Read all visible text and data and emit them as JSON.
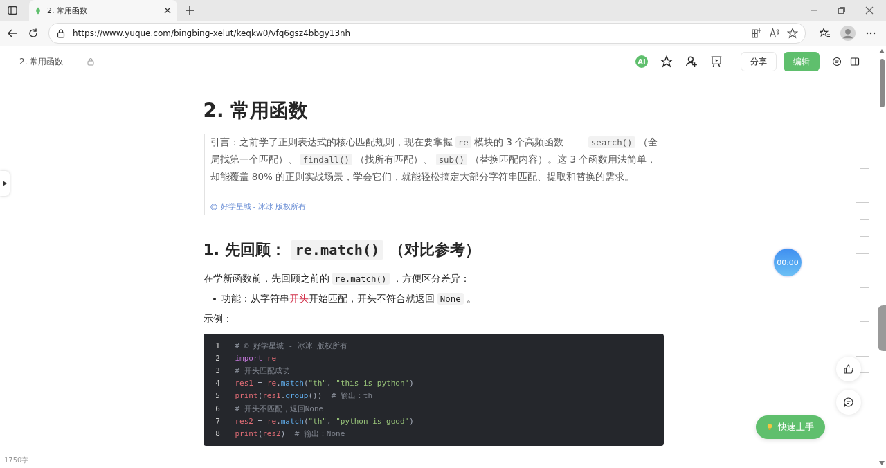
{
  "browser": {
    "tab_title": "2. 常用函数",
    "url": "https://www.yuque.com/bingbing-xelut/keqkw0/vfq6gsz4bbgy13nh"
  },
  "header": {
    "doc_title": "2. 常用函数",
    "ai_badge": "AI",
    "share": "分享",
    "edit": "编辑"
  },
  "doc": {
    "title": "2. 常用函数",
    "intro": [
      {
        "kind": "text",
        "text": "引言：之前学了正则表达式的核心匹配规则，现在要掌握 "
      },
      {
        "kind": "code",
        "text": "re"
      },
      {
        "kind": "text",
        "text": " 模块的 3 个高频函数 —— "
      },
      {
        "kind": "code",
        "text": "search()"
      },
      {
        "kind": "text",
        "text": " （全局找第一个匹配）、 "
      },
      {
        "kind": "code",
        "text": "findall()"
      },
      {
        "kind": "text",
        "text": " （找所有匹配）、 "
      },
      {
        "kind": "code",
        "text": "sub()"
      },
      {
        "kind": "text",
        "text": " （替换匹配内容）。这 3 个函数用法简单，却能覆盖 80% 的正则实战场景，学会它们，就能轻松搞定大部分字符串匹配、提取和替换的需求。"
      }
    ],
    "copyright": "好学星城 - 冰冰 版权所有",
    "section_heading": [
      {
        "kind": "text",
        "text": "1. 先回顾： "
      },
      {
        "kind": "code",
        "text": "re.match()"
      },
      {
        "kind": "text",
        "text": " （对比参考）"
      }
    ],
    "paragraph": [
      {
        "kind": "text",
        "text": "在学新函数前，先回顾之前的 "
      },
      {
        "kind": "code",
        "text": "re.match()"
      },
      {
        "kind": "text",
        "text": " ，方便区分差异："
      }
    ],
    "bullet": [
      {
        "kind": "text",
        "text": "功能：从字符串"
      },
      {
        "kind": "highlight",
        "text": "开头"
      },
      {
        "kind": "text",
        "text": "开始匹配，开头不符合就返回 "
      },
      {
        "kind": "code",
        "text": "None"
      },
      {
        "kind": "text",
        "text": " 。"
      }
    ],
    "example_label": "示例：",
    "code_lines": [
      {
        "number": "1",
        "tokens": [
          {
            "kind": "comment",
            "text": "# © 好学星城 - 冰冰 版权所有"
          }
        ]
      },
      {
        "number": "2",
        "tokens": [
          {
            "kind": "keyword",
            "text": "import"
          },
          {
            "kind": "var",
            "text": " re"
          }
        ]
      },
      {
        "number": "3",
        "tokens": [
          {
            "kind": "comment",
            "text": "# 开头匹配成功"
          }
        ]
      },
      {
        "number": "4",
        "tokens": [
          {
            "kind": "var",
            "text": "res1"
          },
          {
            "kind": "plain",
            "text": " = "
          },
          {
            "kind": "var",
            "text": "re"
          },
          {
            "kind": "plain",
            "text": "."
          },
          {
            "kind": "func",
            "text": "match"
          },
          {
            "kind": "plain",
            "text": "("
          },
          {
            "kind": "string",
            "text": "\"th\""
          },
          {
            "kind": "plain",
            "text": ", "
          },
          {
            "kind": "string",
            "text": "\"this is python\""
          },
          {
            "kind": "plain",
            "text": ")"
          }
        ]
      },
      {
        "number": "5",
        "tokens": [
          {
            "kind": "var",
            "text": "print"
          },
          {
            "kind": "plain",
            "text": "("
          },
          {
            "kind": "var",
            "text": "res1"
          },
          {
            "kind": "plain",
            "text": "."
          },
          {
            "kind": "func",
            "text": "group"
          },
          {
            "kind": "plain",
            "text": "())  "
          },
          {
            "kind": "comment",
            "text": "# 输出：th"
          }
        ]
      },
      {
        "number": "6",
        "tokens": [
          {
            "kind": "comment",
            "text": "# 开头不匹配，返回None"
          }
        ]
      },
      {
        "number": "7",
        "tokens": [
          {
            "kind": "var",
            "text": "res2"
          },
          {
            "kind": "plain",
            "text": " = "
          },
          {
            "kind": "var",
            "text": "re"
          },
          {
            "kind": "plain",
            "text": "."
          },
          {
            "kind": "func",
            "text": "match"
          },
          {
            "kind": "plain",
            "text": "("
          },
          {
            "kind": "string",
            "text": "\"th\""
          },
          {
            "kind": "plain",
            "text": ", "
          },
          {
            "kind": "string",
            "text": "\"python is good\""
          },
          {
            "kind": "plain",
            "text": ")"
          }
        ]
      },
      {
        "number": "8",
        "tokens": [
          {
            "kind": "var",
            "text": "print"
          },
          {
            "kind": "plain",
            "text": "("
          },
          {
            "kind": "var",
            "text": "res2"
          },
          {
            "kind": "plain",
            "text": ")  "
          },
          {
            "kind": "comment",
            "text": "# 输出：None"
          }
        ]
      }
    ]
  },
  "timer": "00:00",
  "quick_start": "快速上手",
  "word_count": "1750字"
}
